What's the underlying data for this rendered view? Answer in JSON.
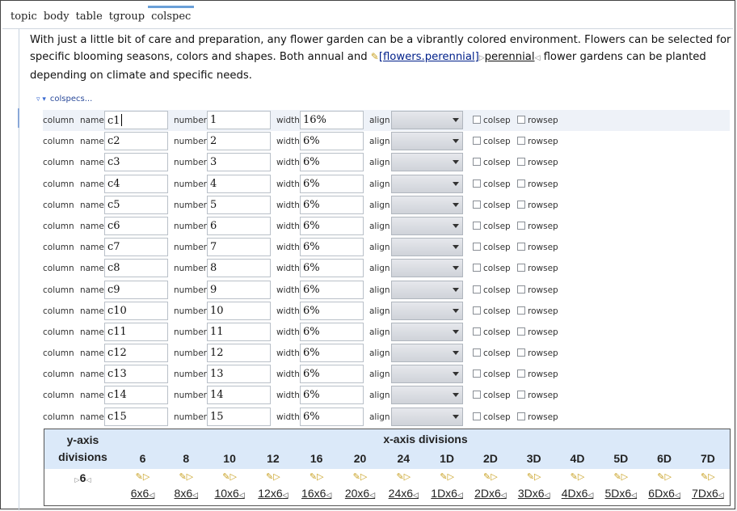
{
  "breadcrumb": [
    "topic",
    "body",
    "table",
    "tgroup",
    "colspec"
  ],
  "paragraph": {
    "text_before": "With just a little bit of care and preparation, any flower garden can be a vibrantly colored environment. Flowers can be selected for specific blooming seasons, colors and shapes. Both annual and ",
    "xref_text": "[flowers.perennial]",
    "term": "perennial",
    "text_after": " flower gardens can be planted depending on climate and specific needs."
  },
  "colspecs_label": "colspecs...",
  "labels": {
    "column": "column",
    "name": "name",
    "number": "number",
    "width": "width",
    "align": "align",
    "colsep": "colsep",
    "rowsep": "rowsep"
  },
  "columns": [
    {
      "name": "c1",
      "number": "1",
      "width": "16%"
    },
    {
      "name": "c2",
      "number": "2",
      "width": "6%"
    },
    {
      "name": "c3",
      "number": "3",
      "width": "6%"
    },
    {
      "name": "c4",
      "number": "4",
      "width": "6%"
    },
    {
      "name": "c5",
      "number": "5",
      "width": "6%"
    },
    {
      "name": "c6",
      "number": "6",
      "width": "6%"
    },
    {
      "name": "c7",
      "number": "7",
      "width": "6%"
    },
    {
      "name": "c8",
      "number": "8",
      "width": "6%"
    },
    {
      "name": "c9",
      "number": "9",
      "width": "6%"
    },
    {
      "name": "c10",
      "number": "10",
      "width": "6%"
    },
    {
      "name": "c11",
      "number": "11",
      "width": "6%"
    },
    {
      "name": "c12",
      "number": "12",
      "width": "6%"
    },
    {
      "name": "c13",
      "number": "13",
      "width": "6%"
    },
    {
      "name": "c14",
      "number": "14",
      "width": "6%"
    },
    {
      "name": "c15",
      "number": "15",
      "width": "6%"
    }
  ],
  "grid_table": {
    "y_header_line1": "y-axis",
    "y_header_line2": "divisions",
    "x_header": "x-axis divisions",
    "y_value": "6",
    "x_columns": [
      "6",
      "8",
      "10",
      "12",
      "16",
      "20",
      "24",
      "1D",
      "2D",
      "3D",
      "4D",
      "5D",
      "6D",
      "7D"
    ],
    "cells": [
      "6x6",
      "8x6",
      "10x6",
      "12x6",
      "16x6",
      "20x6",
      "24x6",
      "1Dx6",
      "2Dx6",
      "3Dx6",
      "4Dx6",
      "5Dx6",
      "6Dx6",
      "7Dx6"
    ]
  },
  "colors": {
    "header_bg": "#dbe9f9",
    "xref": "#00208a",
    "selected_row": "#eef2f8"
  }
}
